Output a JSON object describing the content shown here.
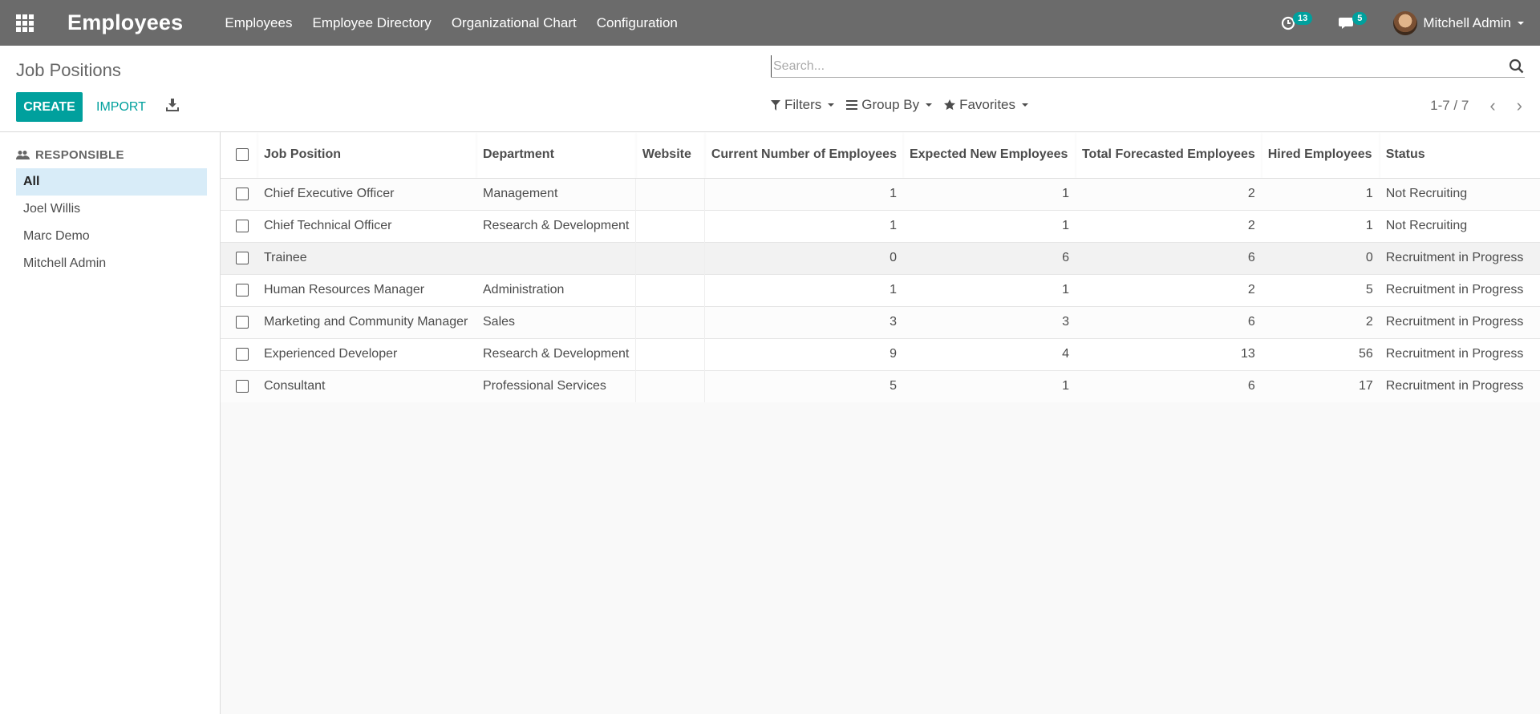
{
  "navbar": {
    "app_title": "Employees",
    "menu": [
      "Employees",
      "Employee Directory",
      "Organizational Chart",
      "Configuration"
    ],
    "activity_count": "13",
    "messages_count": "5",
    "user_name": "Mitchell Admin"
  },
  "control_panel": {
    "breadcrumb": "Job Positions",
    "search_placeholder": "Search...",
    "create_label": "CREATE",
    "import_label": "IMPORT",
    "filters_label": "Filters",
    "groupby_label": "Group By",
    "favorites_label": "Favorites",
    "pager": "1-7 / 7"
  },
  "sidebar": {
    "header": "RESPONSIBLE",
    "items": [
      {
        "label": "All",
        "active": true
      },
      {
        "label": "Joel Willis",
        "active": false
      },
      {
        "label": "Marc Demo",
        "active": false
      },
      {
        "label": "Mitchell Admin",
        "active": false
      }
    ]
  },
  "table": {
    "columns": [
      "Job Position",
      "Department",
      "Website",
      "Current Number of Employees",
      "Expected New Employees",
      "Total Forecasted Employees",
      "Hired Employees",
      "Status"
    ],
    "rows": [
      {
        "job": "Chief Executive Officer",
        "dept": "Management",
        "website": "",
        "current": "1",
        "expected": "1",
        "forecast": "2",
        "hired": "1",
        "status": "Not Recruiting"
      },
      {
        "job": "Chief Technical Officer",
        "dept": "Research & Development",
        "website": "",
        "current": "1",
        "expected": "1",
        "forecast": "2",
        "hired": "1",
        "status": "Not Recruiting"
      },
      {
        "job": "Trainee",
        "dept": "",
        "website": "",
        "current": "0",
        "expected": "6",
        "forecast": "6",
        "hired": "0",
        "status": "Recruitment in Progress"
      },
      {
        "job": "Human Resources Manager",
        "dept": "Administration",
        "website": "",
        "current": "1",
        "expected": "1",
        "forecast": "2",
        "hired": "5",
        "status": "Recruitment in Progress"
      },
      {
        "job": "Marketing and Community Manager",
        "dept": "Sales",
        "website": "",
        "current": "3",
        "expected": "3",
        "forecast": "6",
        "hired": "2",
        "status": "Recruitment in Progress"
      },
      {
        "job": "Experienced Developer",
        "dept": "Research & Development",
        "website": "",
        "current": "9",
        "expected": "4",
        "forecast": "13",
        "hired": "56",
        "status": "Recruitment in Progress"
      },
      {
        "job": "Consultant",
        "dept": "Professional Services",
        "website": "",
        "current": "5",
        "expected": "1",
        "forecast": "6",
        "hired": "17",
        "status": "Recruitment in Progress"
      }
    ]
  },
  "colors": {
    "navbar": "#6b6b6b",
    "primary": "#00a09d",
    "active_filter": "#d8ecf8"
  }
}
